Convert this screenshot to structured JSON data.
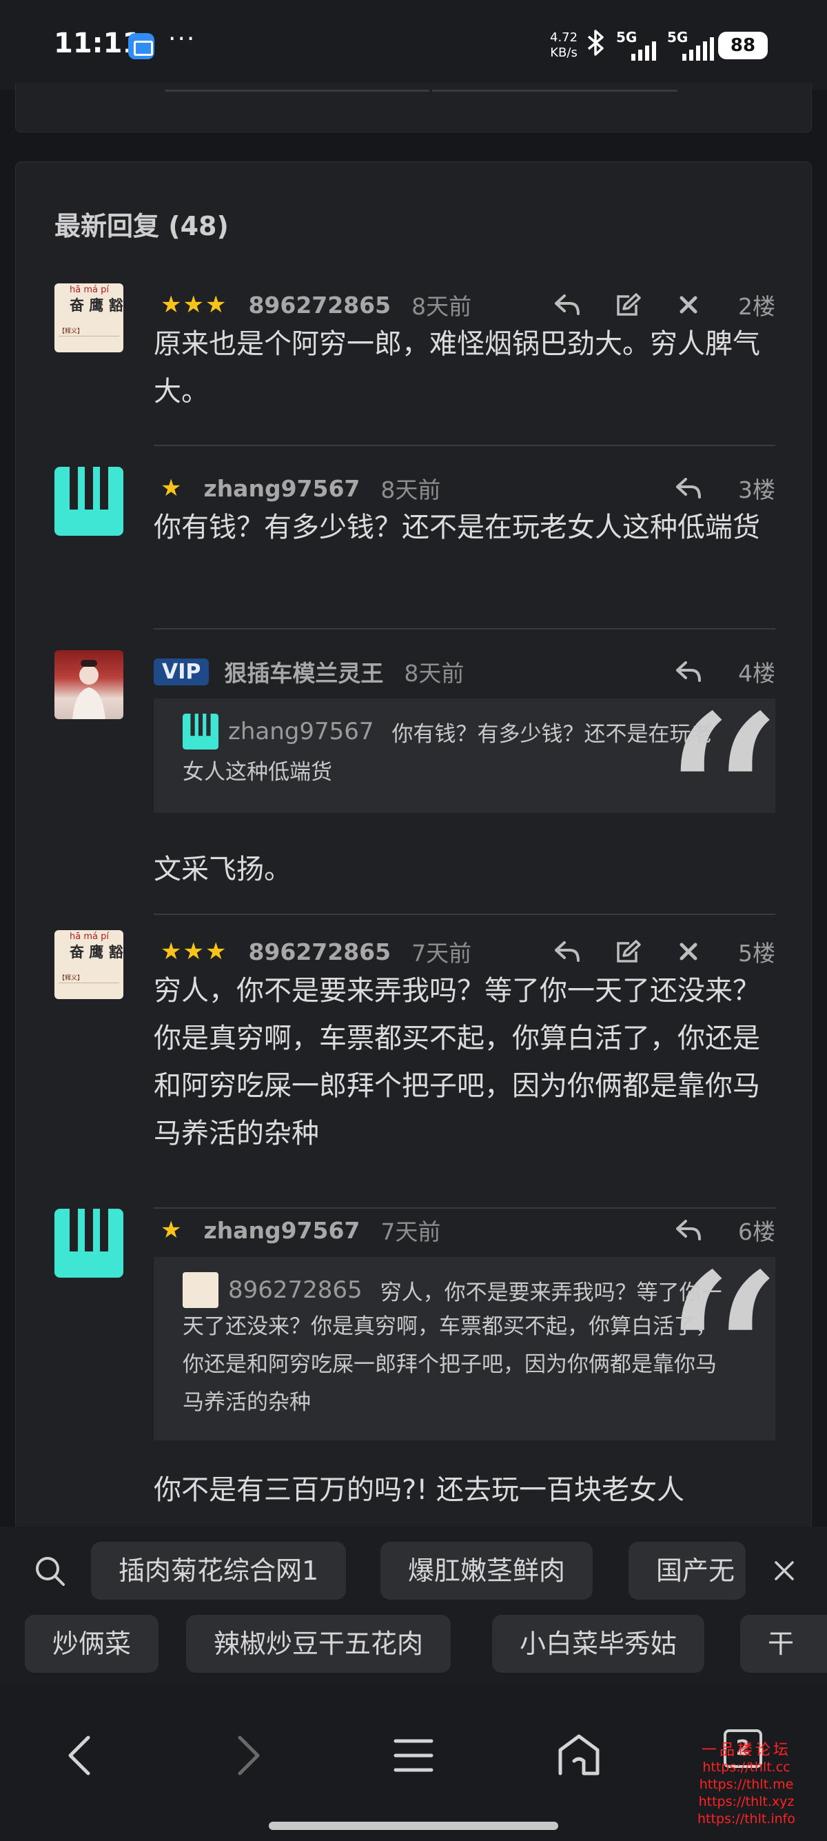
{
  "status_bar": {
    "time": "11:11",
    "dots": "···",
    "net_speed_value": "4.72",
    "net_speed_unit": "KB/s",
    "sim1": "5G",
    "sim2": "5G",
    "battery": "88"
  },
  "replies_section": {
    "title": "最新回复 (48)",
    "replies": [
      {
        "avatar": "dictionary-card",
        "avatar_pinyin": "hā má pí",
        "avatar_chars": "奋 鹰 豁",
        "avatar_tag": "【释义】",
        "rating_stars": "★★★",
        "user": "896272865",
        "time": "8天前",
        "floor": "2楼",
        "content": "原来也是个阿穷一郎，难怪烟锅巴劲大。穷人脾气大。"
      },
      {
        "avatar": "logo-tealcyan",
        "rating_stars": "★",
        "user": "zhang97567",
        "time": "8天前",
        "floor": "3楼",
        "content": "你有钱？有多少钱？还不是在玩老女人这种低端货"
      },
      {
        "avatar": "photo",
        "badge": "VIP",
        "user": "狠插车模兰灵王",
        "time": "8天前",
        "floor": "4楼",
        "quote_user": "zhang97567",
        "quote_first": "你有钱？有多少钱？还不是在玩老",
        "quote_rest": "女人这种低端货",
        "content": "文采飞扬。"
      },
      {
        "avatar": "dictionary-card",
        "avatar_pinyin": "hā má pí",
        "avatar_chars": "奋 鹰 豁",
        "avatar_tag": "【释义】",
        "rating_stars": "★★★",
        "user": "896272865",
        "time": "7天前",
        "floor": "5楼",
        "content": "穷人，你不是要来弄我吗？等了你一天了还没来？你是真穷啊，车票都买不起，你算白活了，你还是和阿穷吃屎一郎拜个把子吧，因为你俩都是靠你马马养活的杂种"
      },
      {
        "avatar": "logo-tealcyan",
        "rating_stars": "★",
        "user": "zhang97567",
        "time": "7天前",
        "floor": "6楼",
        "quote_user": "896272865",
        "quote_first": "穷人，你不是要来弄我吗？等了你一",
        "quote_rest": "天了还没来？你是真穷啊，车票都买不起，你算白活了，你还是和阿穷吃屎一郎拜个把子吧，因为你俩都是靠你马马养活的杂种",
        "content": "你不是有三百万的吗?! 还去玩一百块老女人"
      }
    ]
  },
  "keywords": {
    "row1": [
      "插肉菊花综合网1",
      "爆肛嫩茎鲜肉",
      "国产无"
    ],
    "row2": [
      "炒俩菜",
      "辣椒炒豆干五花肉",
      "小白菜毕秀姑",
      "干"
    ]
  },
  "nav": {
    "tab_count": "2"
  },
  "watermark": {
    "title": "一品楼论坛",
    "lines": [
      "https://thlt.cc",
      "https://thlt.me",
      "https://thlt.xyz",
      "https://thlt.info"
    ]
  },
  "colors": {
    "accent_star": "#f8c41a",
    "logo_teal": "#3ee6d3",
    "vip_blue": "#1f4a8a",
    "watermark_red": "#ff2222"
  }
}
